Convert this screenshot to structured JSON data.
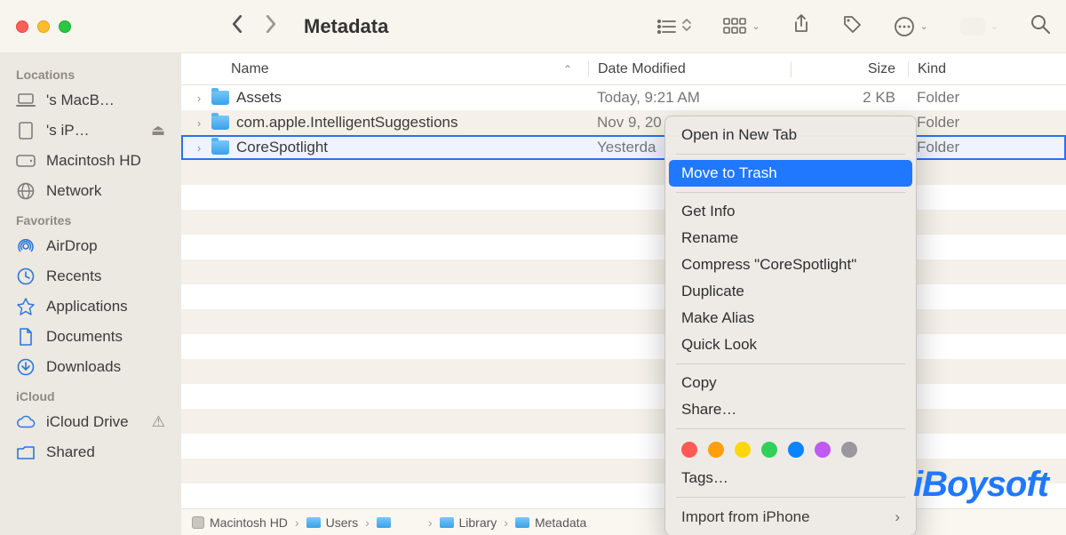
{
  "window": {
    "title": "Metadata"
  },
  "sidebar": {
    "sections": [
      {
        "title": "Locations",
        "items": [
          {
            "icon": "laptop-icon",
            "label": "'s MacB…",
            "trail": ""
          },
          {
            "icon": "ipad-icon",
            "label": "'s iP…",
            "trail": "⏏"
          },
          {
            "icon": "hdd-icon",
            "label": "Macintosh HD",
            "trail": ""
          },
          {
            "icon": "globe-icon",
            "label": "Network",
            "trail": ""
          }
        ]
      },
      {
        "title": "Favorites",
        "items": [
          {
            "icon": "airdrop-icon",
            "label": "AirDrop"
          },
          {
            "icon": "clock-icon",
            "label": "Recents"
          },
          {
            "icon": "apps-icon",
            "label": "Applications"
          },
          {
            "icon": "doc-icon",
            "label": "Documents"
          },
          {
            "icon": "download-icon",
            "label": "Downloads"
          }
        ]
      },
      {
        "title": "iCloud",
        "items": [
          {
            "icon": "cloud-icon",
            "label": "iCloud Drive",
            "trail": "⚠"
          },
          {
            "icon": "shared-icon",
            "label": "Shared"
          }
        ]
      }
    ]
  },
  "columns": {
    "name": "Name",
    "date": "Date Modified",
    "size": "Size",
    "kind": "Kind"
  },
  "rows": [
    {
      "name": "Assets",
      "date": "Today, 9:21 AM",
      "size": "2 KB",
      "kind": "Folder",
      "selected": false
    },
    {
      "name": "com.apple.IntelligentSuggestions",
      "date": "Nov 9, 20",
      "size": "",
      "kind": "Folder",
      "selected": false
    },
    {
      "name": "CoreSpotlight",
      "date": "Yesterda",
      "size": "",
      "kind": "Folder",
      "selected": true
    }
  ],
  "path": {
    "segments": [
      "Macintosh HD",
      "Users",
      "",
      "Library",
      "Metadata"
    ]
  },
  "context_menu": {
    "items": [
      "Open in New Tab",
      "Move to Trash",
      "Get Info",
      "Rename",
      "Compress \"CoreSpotlight\"",
      "Duplicate",
      "Make Alias",
      "Quick Look",
      "Copy",
      "Share…",
      "Tags…",
      "Import from iPhone"
    ],
    "highlighted_index": 1,
    "tag_colors": [
      "#ff5b52",
      "#ff9f0a",
      "#ffd60a",
      "#30d158",
      "#0a84ff",
      "#bf5af2",
      "#98989d"
    ]
  },
  "watermark": "iBoysoft"
}
